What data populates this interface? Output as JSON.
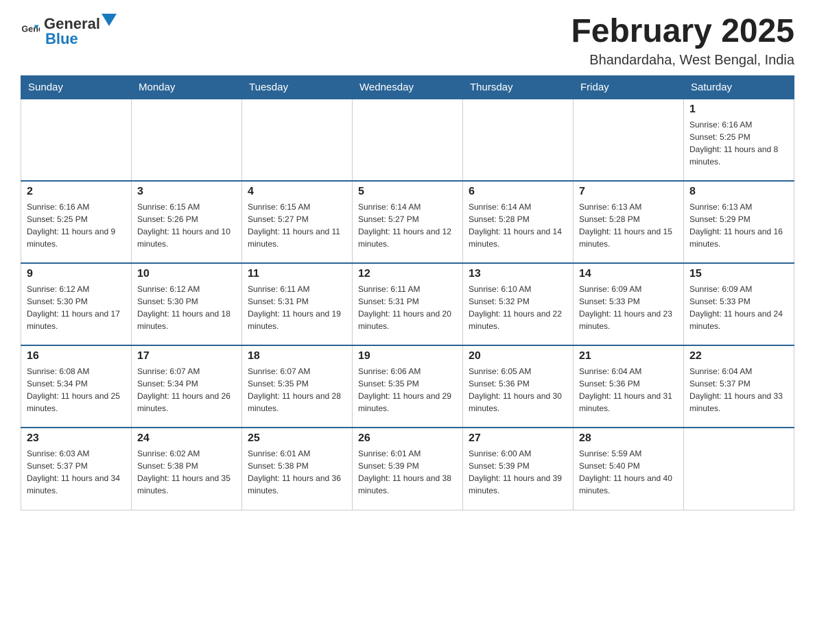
{
  "logo": {
    "general": "General",
    "blue": "Blue"
  },
  "header": {
    "title": "February 2025",
    "subtitle": "Bhandardaha, West Bengal, India"
  },
  "weekdays": [
    "Sunday",
    "Monday",
    "Tuesday",
    "Wednesday",
    "Thursday",
    "Friday",
    "Saturday"
  ],
  "weeks": [
    [
      {
        "day": "",
        "info": ""
      },
      {
        "day": "",
        "info": ""
      },
      {
        "day": "",
        "info": ""
      },
      {
        "day": "",
        "info": ""
      },
      {
        "day": "",
        "info": ""
      },
      {
        "day": "",
        "info": ""
      },
      {
        "day": "1",
        "info": "Sunrise: 6:16 AM\nSunset: 5:25 PM\nDaylight: 11 hours and 8 minutes."
      }
    ],
    [
      {
        "day": "2",
        "info": "Sunrise: 6:16 AM\nSunset: 5:25 PM\nDaylight: 11 hours and 9 minutes."
      },
      {
        "day": "3",
        "info": "Sunrise: 6:15 AM\nSunset: 5:26 PM\nDaylight: 11 hours and 10 minutes."
      },
      {
        "day": "4",
        "info": "Sunrise: 6:15 AM\nSunset: 5:27 PM\nDaylight: 11 hours and 11 minutes."
      },
      {
        "day": "5",
        "info": "Sunrise: 6:14 AM\nSunset: 5:27 PM\nDaylight: 11 hours and 12 minutes."
      },
      {
        "day": "6",
        "info": "Sunrise: 6:14 AM\nSunset: 5:28 PM\nDaylight: 11 hours and 14 minutes."
      },
      {
        "day": "7",
        "info": "Sunrise: 6:13 AM\nSunset: 5:28 PM\nDaylight: 11 hours and 15 minutes."
      },
      {
        "day": "8",
        "info": "Sunrise: 6:13 AM\nSunset: 5:29 PM\nDaylight: 11 hours and 16 minutes."
      }
    ],
    [
      {
        "day": "9",
        "info": "Sunrise: 6:12 AM\nSunset: 5:30 PM\nDaylight: 11 hours and 17 minutes."
      },
      {
        "day": "10",
        "info": "Sunrise: 6:12 AM\nSunset: 5:30 PM\nDaylight: 11 hours and 18 minutes."
      },
      {
        "day": "11",
        "info": "Sunrise: 6:11 AM\nSunset: 5:31 PM\nDaylight: 11 hours and 19 minutes."
      },
      {
        "day": "12",
        "info": "Sunrise: 6:11 AM\nSunset: 5:31 PM\nDaylight: 11 hours and 20 minutes."
      },
      {
        "day": "13",
        "info": "Sunrise: 6:10 AM\nSunset: 5:32 PM\nDaylight: 11 hours and 22 minutes."
      },
      {
        "day": "14",
        "info": "Sunrise: 6:09 AM\nSunset: 5:33 PM\nDaylight: 11 hours and 23 minutes."
      },
      {
        "day": "15",
        "info": "Sunrise: 6:09 AM\nSunset: 5:33 PM\nDaylight: 11 hours and 24 minutes."
      }
    ],
    [
      {
        "day": "16",
        "info": "Sunrise: 6:08 AM\nSunset: 5:34 PM\nDaylight: 11 hours and 25 minutes."
      },
      {
        "day": "17",
        "info": "Sunrise: 6:07 AM\nSunset: 5:34 PM\nDaylight: 11 hours and 26 minutes."
      },
      {
        "day": "18",
        "info": "Sunrise: 6:07 AM\nSunset: 5:35 PM\nDaylight: 11 hours and 28 minutes."
      },
      {
        "day": "19",
        "info": "Sunrise: 6:06 AM\nSunset: 5:35 PM\nDaylight: 11 hours and 29 minutes."
      },
      {
        "day": "20",
        "info": "Sunrise: 6:05 AM\nSunset: 5:36 PM\nDaylight: 11 hours and 30 minutes."
      },
      {
        "day": "21",
        "info": "Sunrise: 6:04 AM\nSunset: 5:36 PM\nDaylight: 11 hours and 31 minutes."
      },
      {
        "day": "22",
        "info": "Sunrise: 6:04 AM\nSunset: 5:37 PM\nDaylight: 11 hours and 33 minutes."
      }
    ],
    [
      {
        "day": "23",
        "info": "Sunrise: 6:03 AM\nSunset: 5:37 PM\nDaylight: 11 hours and 34 minutes."
      },
      {
        "day": "24",
        "info": "Sunrise: 6:02 AM\nSunset: 5:38 PM\nDaylight: 11 hours and 35 minutes."
      },
      {
        "day": "25",
        "info": "Sunrise: 6:01 AM\nSunset: 5:38 PM\nDaylight: 11 hours and 36 minutes."
      },
      {
        "day": "26",
        "info": "Sunrise: 6:01 AM\nSunset: 5:39 PM\nDaylight: 11 hours and 38 minutes."
      },
      {
        "day": "27",
        "info": "Sunrise: 6:00 AM\nSunset: 5:39 PM\nDaylight: 11 hours and 39 minutes."
      },
      {
        "day": "28",
        "info": "Sunrise: 5:59 AM\nSunset: 5:40 PM\nDaylight: 11 hours and 40 minutes."
      },
      {
        "day": "",
        "info": ""
      }
    ]
  ]
}
